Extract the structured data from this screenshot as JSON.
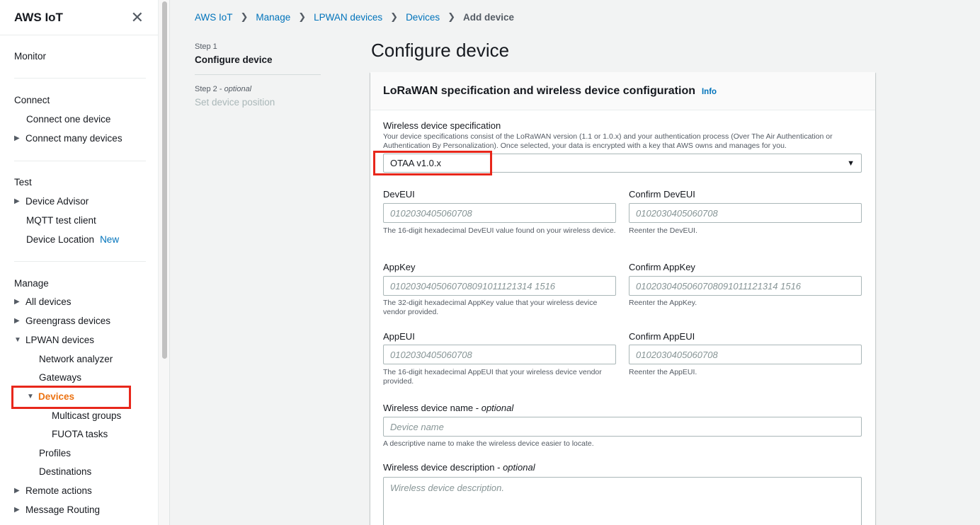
{
  "sidebar": {
    "title": "AWS IoT",
    "monitor": "Monitor",
    "connect": {
      "heading": "Connect",
      "connect_one": "Connect one device",
      "connect_many": "Connect many devices"
    },
    "test": {
      "heading": "Test",
      "device_advisor": "Device Advisor",
      "mqtt_client": "MQTT test client",
      "device_location": "Device Location",
      "new_badge": "New"
    },
    "manage": {
      "heading": "Manage",
      "all_devices": "All devices",
      "greengrass": "Greengrass devices",
      "lpwan": "LPWAN devices",
      "network_analyzer": "Network analyzer",
      "gateways": "Gateways",
      "devices": "Devices",
      "multicast": "Multicast groups",
      "fuota": "FUOTA tasks",
      "profiles": "Profiles",
      "destinations": "Destinations",
      "remote_actions": "Remote actions",
      "message_routing": "Message Routing"
    }
  },
  "breadcrumb": [
    "AWS IoT",
    "Manage",
    "LPWAN devices",
    "Devices"
  ],
  "breadcrumb_current": "Add device",
  "steps": {
    "step1_num": "Step 1",
    "step1_name": "Configure device",
    "step2_num": "Step 2",
    "step2_optional": "optional",
    "step2_name": "Set device position"
  },
  "page_title": "Configure device",
  "panel": {
    "title": "LoRaWAN specification and wireless device configuration",
    "info": "Info"
  },
  "form": {
    "spec_label": "Wireless device specification",
    "spec_desc": "Your device specifications consist of the LoRaWAN version (1.1 or 1.0.x) and your authentication process (Over The Air Authentication or Authentication By Personalization). Once selected, your data is encrypted with a key that AWS owns and manages for you.",
    "spec_value": "OTAA v1.0.x",
    "deveui_label": "DevEUI",
    "deveui_placeholder": "0102030405060708",
    "deveui_desc": "The 16-digit hexadecimal DevEUI value found on your wireless device.",
    "confirm_deveui_label": "Confirm DevEUI",
    "confirm_deveui_placeholder": "0102030405060708",
    "confirm_deveui_desc": "Reenter the DevEUI.",
    "appkey_label": "AppKey",
    "appkey_placeholder": "0102030405060708091011121314 1516",
    "appkey_desc": "The 32-digit hexadecimal AppKey value that your wireless device vendor provided.",
    "confirm_appkey_label": "Confirm AppKey",
    "confirm_appkey_placeholder": "0102030405060708091011121314 1516",
    "confirm_appkey_desc": "Reenter the AppKey.",
    "appeui_label": "AppEUI",
    "appeui_placeholder": "0102030405060708",
    "appeui_desc": "The 16-digit hexadecimal AppEUI that your wireless device vendor provided.",
    "confirm_appeui_label": "Confirm AppEUI",
    "confirm_appeui_placeholder": "0102030405060708",
    "confirm_appeui_desc": "Reenter the AppEUI.",
    "name_label": "Wireless device name",
    "optional": "optional",
    "name_placeholder": "Device name",
    "name_desc": "A descriptive name to make the wireless device easier to locate.",
    "description_label": "Wireless device description",
    "description_placeholder": "Wireless device description."
  },
  "colors": {
    "highlight": "#e8271b",
    "link": "#0073bb",
    "active_nav": "#ec7211"
  }
}
